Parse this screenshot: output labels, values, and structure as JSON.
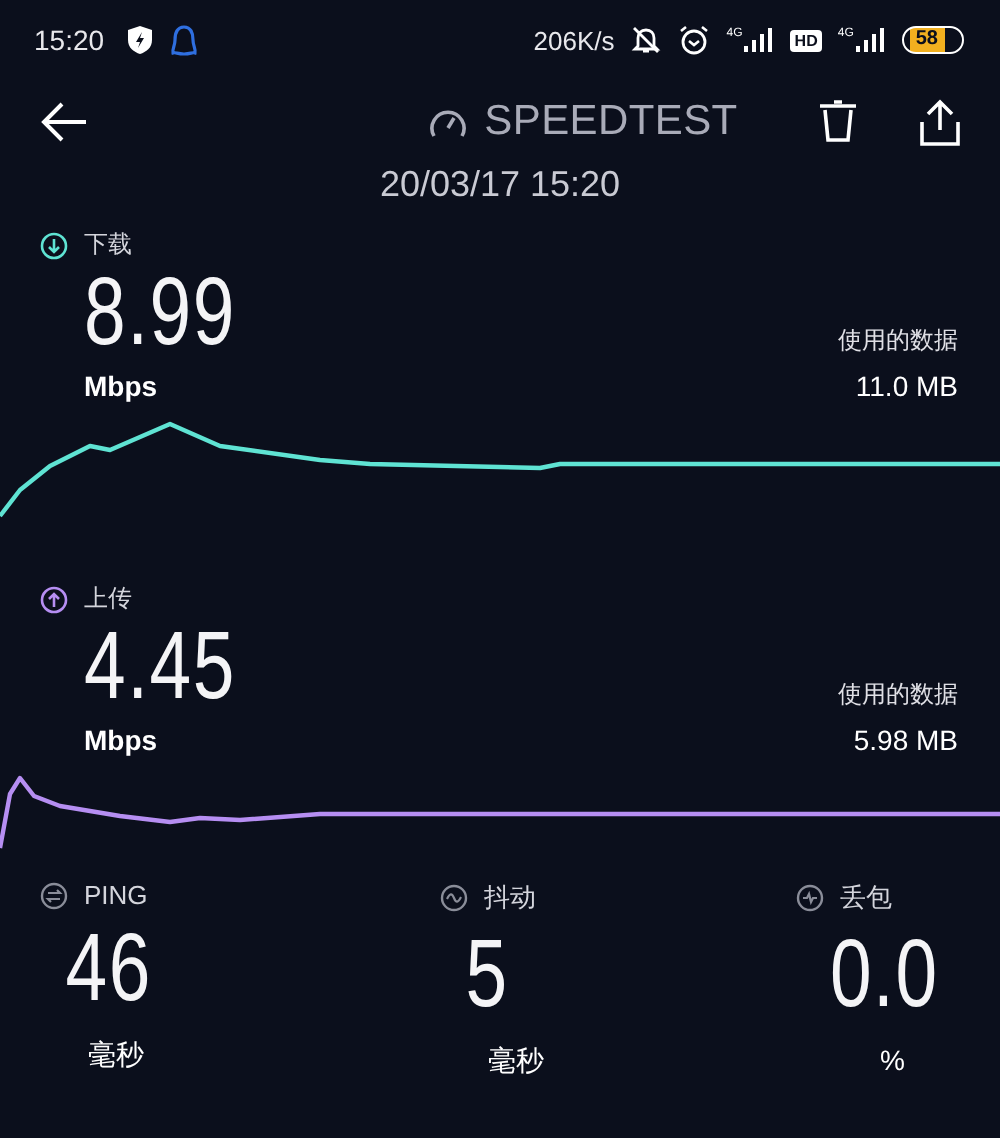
{
  "status_bar": {
    "time": "15:20",
    "speed": "206K/s",
    "signals": [
      {
        "network": "4G"
      },
      {
        "network": "4G"
      }
    ],
    "hd_badge": "HD",
    "battery": "58"
  },
  "header": {
    "title": "SPEEDTEST",
    "date": "20/03/17 15:20"
  },
  "sections": [
    {
      "kind": "download",
      "label": "下载",
      "value": "8.99",
      "unit": "Mbps",
      "data_label": "使用的数据",
      "data_value": "11.0 MB",
      "color": "#5fe3d3"
    },
    {
      "kind": "upload",
      "label": "上传",
      "value": "4.45",
      "unit": "Mbps",
      "data_label": "使用的数据",
      "data_value": "5.98 MB",
      "color": "#b68ef2"
    }
  ],
  "stats": [
    {
      "kind": "ping",
      "label": "PING",
      "value": "46",
      "unit": "毫秒"
    },
    {
      "kind": "jitter",
      "label": "抖动",
      "value": "5",
      "unit": "毫秒"
    },
    {
      "kind": "loss",
      "label": "丢包",
      "value": "0.0",
      "unit": "%"
    }
  ]
}
